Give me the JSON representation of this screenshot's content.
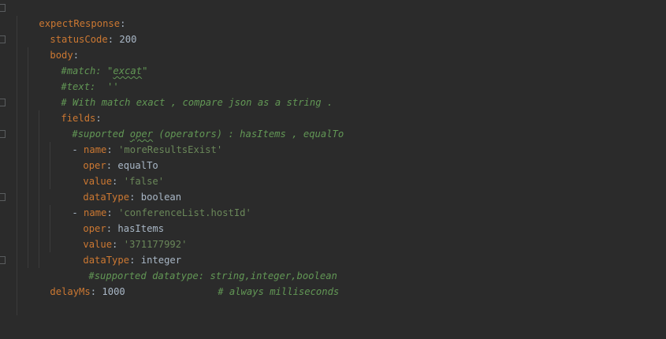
{
  "editor": {
    "lines": [
      {
        "key": "expectResponse",
        "colon": ":"
      },
      {
        "key": "statusCode",
        "colon": ": ",
        "value": "200"
      },
      {
        "key": "body",
        "colon": ":"
      },
      {
        "c1": "#match: \"",
        "c2": "excat",
        "c3": "\""
      },
      {
        "comment": "#text:  ''"
      },
      {
        "comment": "# With match exact , compare json as a string ."
      },
      {
        "key": "fields",
        "colon": ":"
      },
      {
        "c1": "#suported ",
        "c2": "oper",
        "c3": " (operators) : hasItems , equalTo"
      },
      {
        "dash": "- ",
        "key": "name",
        "colon": ": ",
        "value": "'moreResultsExist'"
      },
      {
        "key": "oper",
        "colon": ": ",
        "value": "equalTo"
      },
      {
        "key": "value",
        "colon": ": ",
        "value": "'false'"
      },
      {
        "key": "dataType",
        "colon": ": ",
        "value": "boolean"
      },
      {
        "dash": "- ",
        "key": "name",
        "colon": ": ",
        "value": "'conferenceList.hostId'"
      },
      {
        "key": "oper",
        "colon": ": ",
        "value": "hasItems"
      },
      {
        "key": "value",
        "colon": ": ",
        "value": "'371177992'"
      },
      {
        "key": "dataType",
        "colon": ": ",
        "value": "integer"
      },
      {
        "comment": "#supported datatype: string,integer,boolean"
      },
      {
        "key": "delayMs",
        "colon": ": ",
        "value": "1000",
        "gap": "                ",
        "comment": "# always milliseconds"
      }
    ]
  }
}
